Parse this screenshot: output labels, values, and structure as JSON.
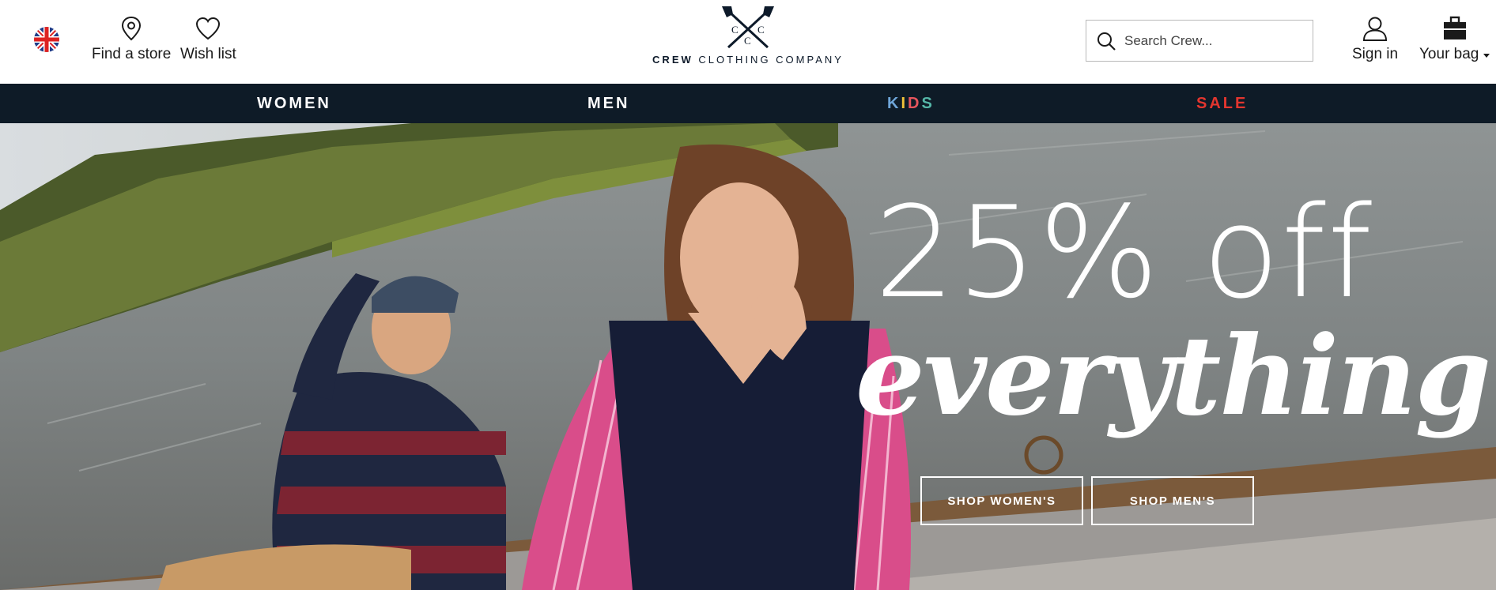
{
  "header": {
    "locale_flag": "uk-flag-icon",
    "find_store_label": "Find a store",
    "wish_list_label": "Wish list",
    "logo_initials": "C C C",
    "logo_word_bold": "CREW",
    "logo_word_rest": "CLOTHING COMPANY",
    "search_placeholder": "Search Crew...",
    "sign_in_label": "Sign in",
    "bag_label": "Your bag"
  },
  "nav": {
    "women": "WOMEN",
    "men": "MEN",
    "kids_letters": [
      "K",
      "I",
      "D",
      "S"
    ],
    "sale": "SALE"
  },
  "hero": {
    "headline_line1": "25% off",
    "headline_line2": "everything",
    "cta_women": "SHOP WOMEN'S",
    "cta_men": "SHOP MEN'S"
  },
  "colors": {
    "nav_bg": "#0e1b27",
    "sale": "#e3362f",
    "kids": [
      "#6fa6d9",
      "#f1c33a",
      "#e6555d",
      "#55b7a8"
    ]
  }
}
